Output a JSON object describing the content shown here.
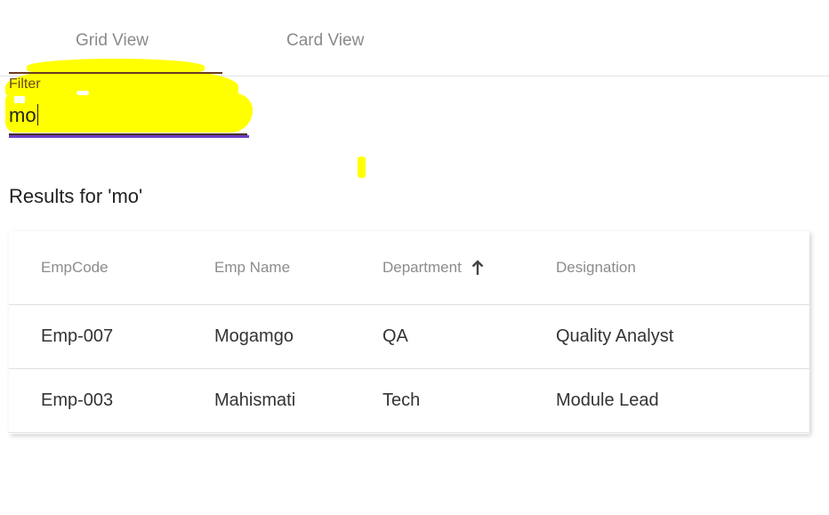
{
  "tabs": [
    {
      "label": "Grid View"
    },
    {
      "label": "Card View"
    }
  ],
  "filter": {
    "label": "Filter",
    "value": "mo"
  },
  "results": {
    "title": "Results for 'mo'"
  },
  "table": {
    "headers": [
      "EmpCode",
      "Emp Name",
      "Department",
      "Designation"
    ],
    "sorted_column": "Department",
    "sort_direction": "ascending",
    "sort_icon": "arrow-up-icon",
    "rows": [
      [
        "Emp-007",
        "Mogamgo",
        "QA",
        "Quality Analyst"
      ],
      [
        "Emp-003",
        "Mahismati",
        "Tech",
        "Module Lead"
      ]
    ]
  },
  "colors": {
    "highlight": "#ffff00",
    "input_underline": "#6a3fc6",
    "tab_text": "#8a8a8a"
  }
}
